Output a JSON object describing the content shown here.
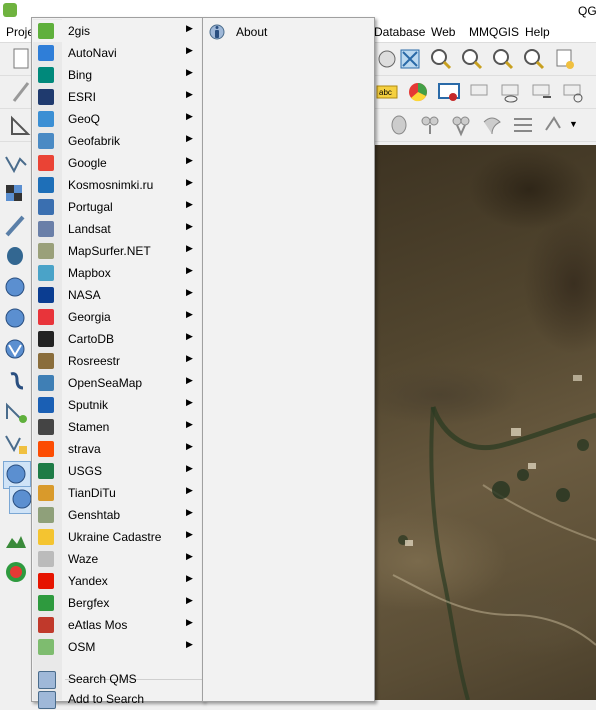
{
  "window": {
    "title": "QG"
  },
  "menubar": {
    "items": [
      {
        "id": "project",
        "label": "Proje"
      },
      {
        "id": "database",
        "label": "Database"
      },
      {
        "id": "web",
        "label": "Web"
      },
      {
        "id": "mmqgis",
        "label": "MMQGIS"
      },
      {
        "id": "help",
        "label": "Help"
      }
    ]
  },
  "providers_menu": {
    "items": [
      {
        "label": "2gis",
        "icon": "2gis-icon",
        "color": "#5fb03c"
      },
      {
        "label": "AutoNavi",
        "icon": "autonavi-icon",
        "color": "#2f7ed8"
      },
      {
        "label": "Bing",
        "icon": "bing-icon",
        "color": "#00897b"
      },
      {
        "label": "ESRI",
        "icon": "esri-icon",
        "color": "#1f3a6e"
      },
      {
        "label": "GeoQ",
        "icon": "geoq-icon",
        "color": "#3b8fd4"
      },
      {
        "label": "Geofabrik",
        "icon": "geofabrik-icon",
        "color": "#4a8ac4"
      },
      {
        "label": "Google",
        "icon": "google-icon",
        "color": "#ea4335"
      },
      {
        "label": "Kosmosnimki.ru",
        "icon": "kosmosnimki-icon",
        "color": "#1e6fb8"
      },
      {
        "label": "Portugal",
        "icon": "portugal-icon",
        "color": "#3a6fb0"
      },
      {
        "label": "Landsat",
        "icon": "landsat-icon",
        "color": "#6a7fa8"
      },
      {
        "label": "MapSurfer.NET",
        "icon": "mapsurfer-icon",
        "color": "#9aa07a"
      },
      {
        "label": "Mapbox",
        "icon": "mapbox-icon",
        "color": "#4aa3c8"
      },
      {
        "label": "NASA",
        "icon": "nasa-icon",
        "color": "#0b3d91"
      },
      {
        "label": "Georgia",
        "icon": "georgia-icon",
        "color": "#e8343a"
      },
      {
        "label": "CartoDB",
        "icon": "cartodb-icon",
        "color": "#222222"
      },
      {
        "label": "Rosreestr",
        "icon": "rosreestr-icon",
        "color": "#8a6d3b"
      },
      {
        "label": "OpenSeaMap",
        "icon": "openseamap-icon",
        "color": "#3f7fb5"
      },
      {
        "label": "Sputnik",
        "icon": "sputnik-icon",
        "color": "#1a5fb4"
      },
      {
        "label": "Stamen",
        "icon": "stamen-icon",
        "color": "#444444"
      },
      {
        "label": "strava",
        "icon": "strava-icon",
        "color": "#fc4c02"
      },
      {
        "label": "USGS",
        "icon": "usgs-icon",
        "color": "#1e7b46"
      },
      {
        "label": "TianDiTu",
        "icon": "tianditu-icon",
        "color": "#d99a2b"
      },
      {
        "label": "Genshtab",
        "icon": "genshtab-icon",
        "color": "#8fa07a"
      },
      {
        "label": "Ukraine Cadastre",
        "icon": "ukraine-cadastre-icon",
        "color": "#f4c430"
      },
      {
        "label": "Waze",
        "icon": "waze-icon",
        "color": "#bbbbbb"
      },
      {
        "label": "Yandex",
        "icon": "yandex-icon",
        "color": "#e61400"
      },
      {
        "label": "Bergfex",
        "icon": "bergfex-icon",
        "color": "#2e9a3e"
      },
      {
        "label": "eAtlas Mos",
        "icon": "eatlas-mos-icon",
        "color": "#c0392b"
      },
      {
        "label": "OSM",
        "icon": "osm-icon",
        "color": "#7ebc6f"
      }
    ],
    "actions": [
      {
        "label": "Search QMS",
        "icon": "search-qms-icon"
      },
      {
        "label": "Add to Search",
        "icon": "add-to-search-icon"
      }
    ]
  },
  "about_submenu": {
    "label": "About",
    "icon": "info-globe-icon"
  }
}
